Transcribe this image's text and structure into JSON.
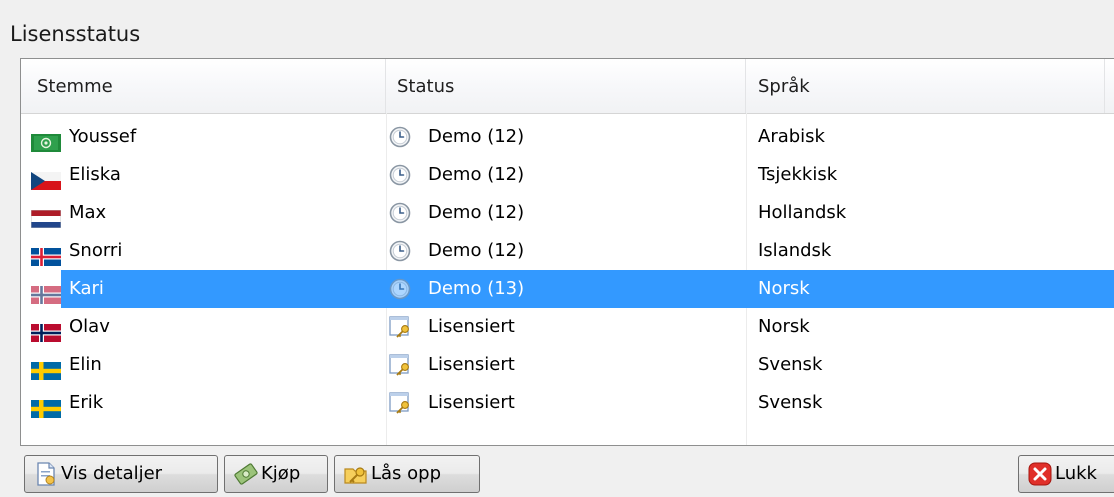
{
  "title": "Lisensstatus",
  "columns": {
    "voice": "Stemme",
    "status": "Status",
    "language": "Språk"
  },
  "rows": [
    {
      "voice": "Youssef",
      "flag": "saudi-arabia-flag",
      "status": "Demo (12)",
      "status_icon": "clock-icon",
      "language": "Arabisk"
    },
    {
      "voice": "Eliska",
      "flag": "czech-flag",
      "status": "Demo (12)",
      "status_icon": "clock-icon",
      "language": "Tsjekkisk"
    },
    {
      "voice": "Max",
      "flag": "netherlands-flag",
      "status": "Demo (12)",
      "status_icon": "clock-icon",
      "language": "Hollandsk"
    },
    {
      "voice": "Snorri",
      "flag": "iceland-flag",
      "status": "Demo (12)",
      "status_icon": "clock-icon",
      "language": "Islandsk"
    },
    {
      "voice": "Kari",
      "flag": "norway-flag",
      "status": "Demo (13)",
      "status_icon": "clock-icon",
      "language": "Norsk",
      "selected": true
    },
    {
      "voice": "Olav",
      "flag": "norway-flag",
      "status": "Lisensiert",
      "status_icon": "license-key-icon",
      "language": "Norsk"
    },
    {
      "voice": "Elin",
      "flag": "sweden-flag",
      "status": "Lisensiert",
      "status_icon": "license-key-icon",
      "language": "Svensk"
    },
    {
      "voice": "Erik",
      "flag": "sweden-flag",
      "status": "Lisensiert",
      "status_icon": "license-key-icon",
      "language": "Svensk"
    }
  ],
  "buttons": {
    "details": "Vis detaljer",
    "buy": "Kjøp",
    "unlock": "Lås opp",
    "close": "Lukk"
  },
  "colors": {
    "selection": "#3399ff",
    "close_icon": "#e0302a"
  }
}
